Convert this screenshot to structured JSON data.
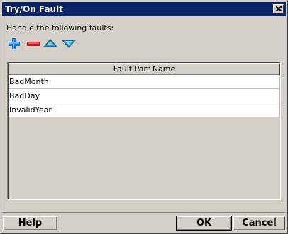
{
  "window": {
    "title": "Try/On Fault"
  },
  "instruction": "Handle the following faults:",
  "toolbar": {
    "add_icon": "plus-icon",
    "remove_icon": "minus-icon",
    "move_up_icon": "triangle-up-icon",
    "move_down_icon": "triangle-down-icon"
  },
  "table": {
    "column_header": "Fault Part Name",
    "rows": [
      "BadMonth",
      "BadDay",
      "InvalidYear"
    ]
  },
  "buttons": {
    "help": "Help",
    "ok": "OK",
    "cancel": "Cancel"
  },
  "colors": {
    "titlebar": "#0a246a",
    "dialog_bg": "#d4d0c8",
    "add": "#1e6fd0",
    "remove": "#d02020",
    "arrows": "#2e9ad0"
  }
}
